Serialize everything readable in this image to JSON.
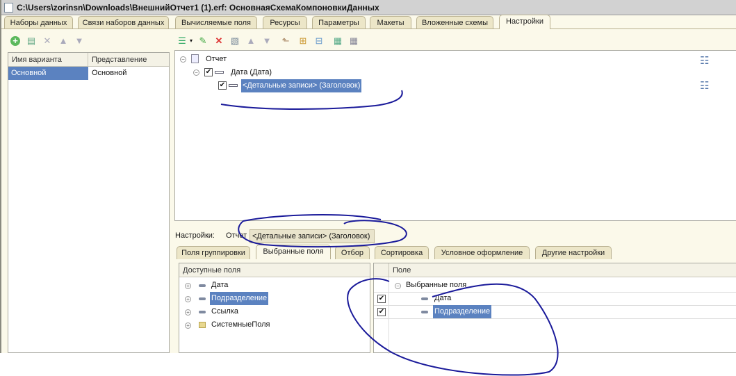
{
  "title": "C:\\Users\\zorinsn\\Downloads\\ВнешнийОтчет1 (1).erf: ОсновнаяСхемаКомпоновкиДанных",
  "tabs": [
    "Наборы данных",
    "Связи наборов данных",
    "Вычисляемые поля",
    "Ресурсы",
    "Параметры",
    "Макеты",
    "Вложенные схемы",
    "Настройки"
  ],
  "variants": {
    "headers": [
      "Имя варианта",
      "Представление"
    ],
    "rows": [
      [
        "Основной",
        "Основной"
      ]
    ]
  },
  "tree": {
    "root": "Отчет",
    "group": "Дата (Дата)",
    "detail": "<Детальные записи> (Заголовок)"
  },
  "settings": {
    "label": "Настройки:",
    "path_root": "Отчет",
    "path_current": "<Детальные записи> (Заголовок)"
  },
  "subtabs": [
    "Поля группировки",
    "Выбранные поля",
    "Отбор",
    "Сортировка",
    "Условное оформление",
    "Другие настройки"
  ],
  "available": {
    "header": "Доступные поля",
    "items": [
      "Дата",
      "Подразделение",
      "Ссылка",
      "СистемныеПоля"
    ]
  },
  "selected": {
    "header": "Поле",
    "group": "Выбранные поля",
    "items": [
      "Дата",
      "Подразделение"
    ]
  }
}
